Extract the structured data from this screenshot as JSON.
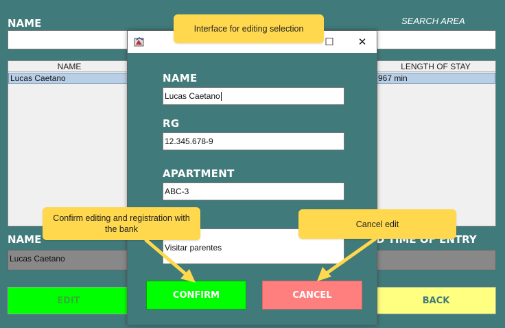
{
  "main": {
    "name_heading": "NAME",
    "search_area_label": "SEARCH AREA",
    "search_value": "",
    "table": {
      "headers": [
        "NAME",
        "LENGTH OF STAY"
      ],
      "rows": [
        {
          "name": "Lucas Caetano",
          "length_of_stay": "967 min"
        }
      ]
    },
    "bottom_name_label": "NAME",
    "bottom_time_label": "D TIME OF ENTRY",
    "selected_name_value": "Lucas Caetano",
    "edit_label": "EDIT",
    "back_label": "BACK"
  },
  "dialog": {
    "name_label": "NAME",
    "name_value": "Lucas Caetano",
    "rg_label": "RG",
    "rg_value": "12.345.678-9",
    "apartment_label": "APARTMENT",
    "apartment_value": "ABC-3",
    "reason_value": "Visitar parentes",
    "confirm_label": "CONFIRM",
    "cancel_label": "CANCEL",
    "maximize_glyph": "☐",
    "close_glyph": "✕"
  },
  "callouts": {
    "dialog_title": "Interface for editing selection",
    "confirm_note": "Confirm editing and registration with the bank",
    "cancel_note": "Cancel edit"
  },
  "colors": {
    "background": "#417A7A",
    "edit_button": "#00FF00",
    "back_button": "#FFFF80",
    "confirm_button": "#00FF00",
    "cancel_button": "#FF7F7F",
    "callout": "#FFD84D"
  }
}
